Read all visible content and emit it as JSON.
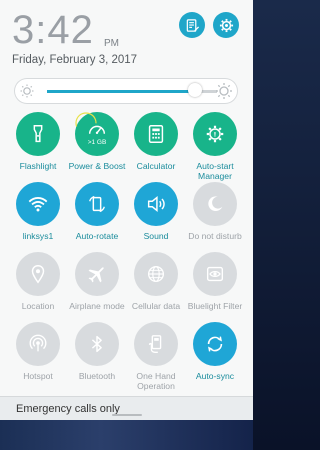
{
  "status": {
    "time": "3:42",
    "ampm": "PM",
    "date": "Friday, February 3, 2017"
  },
  "brightness": {
    "level_percent": 87
  },
  "tiles": [
    {
      "label": "Flashlight",
      "state": "on",
      "color": "teal",
      "icon": "flashlight-icon"
    },
    {
      "label": "Power & Boost",
      "state": "on",
      "color": "teal",
      "icon": "speedometer-icon",
      "sublabel": ">1 GB"
    },
    {
      "label": "Calculator",
      "state": "on",
      "color": "teal",
      "icon": "calculator-icon"
    },
    {
      "label": "Auto-start Manager",
      "state": "on",
      "color": "teal",
      "icon": "gear-shield-icon"
    },
    {
      "label": "linksys1",
      "state": "on",
      "color": "blue",
      "icon": "wifi-icon"
    },
    {
      "label": "Auto-rotate",
      "state": "on",
      "color": "blue",
      "icon": "auto-rotate-icon"
    },
    {
      "label": "Sound",
      "state": "on",
      "color": "blue",
      "icon": "speaker-icon"
    },
    {
      "label": "Do not disturb",
      "state": "off",
      "color": "gray",
      "icon": "moon-icon"
    },
    {
      "label": "Location",
      "state": "off",
      "color": "gray",
      "icon": "location-pin-icon"
    },
    {
      "label": "Airplane mode",
      "state": "off",
      "color": "gray",
      "icon": "airplane-icon"
    },
    {
      "label": "Cellular data",
      "state": "off",
      "color": "gray",
      "icon": "globe-icon"
    },
    {
      "label": "Bluelight Filter",
      "state": "off",
      "color": "gray",
      "icon": "eye-filter-icon"
    },
    {
      "label": "Hotspot",
      "state": "off",
      "color": "gray",
      "icon": "hotspot-icon"
    },
    {
      "label": "Bluetooth",
      "state": "off",
      "color": "gray",
      "icon": "bluetooth-icon"
    },
    {
      "label": "One Hand Operation",
      "state": "off",
      "color": "gray",
      "icon": "one-hand-icon"
    },
    {
      "label": "Auto-sync",
      "state": "on",
      "color": "blue",
      "icon": "sync-icon"
    }
  ],
  "footer": {
    "emergency_text": "Emergency calls only"
  },
  "colors": {
    "teal": "#18b48a",
    "blue": "#1fa6d6",
    "gray": "#d8dbde",
    "accent": "#1fa6c9"
  }
}
